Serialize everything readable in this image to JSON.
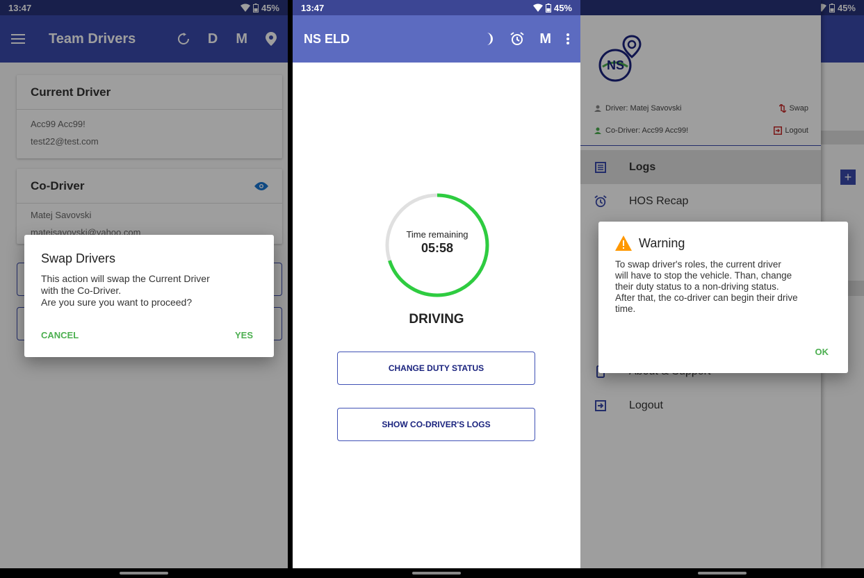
{
  "colors": {
    "primary": "#3949ab",
    "primary_dark": "#27327a",
    "accent_green": "#4caf50",
    "warning": "#ff9800",
    "ring_track": "#e0e0e0",
    "ring_fill": "#2ecc40"
  },
  "status_bar": {
    "time": "13:47",
    "battery": "45%"
  },
  "screen1": {
    "appbar": {
      "title": "Team Drivers",
      "actions": [
        "sync-icon",
        "D",
        "M",
        "location-icon"
      ]
    },
    "current_driver": {
      "heading": "Current Driver",
      "name": "Acc99 Acc99!",
      "email": "test22@test.com"
    },
    "co_driver": {
      "heading": "Co-Driver",
      "name": "Matej Savovski",
      "email": "matejsavovski@yahoo.com"
    },
    "dialog": {
      "title": "Swap Drivers",
      "message_line1": "This action will swap the Current Driver",
      "message_line2": "with the Co-Driver.",
      "message_line3": "Are you sure you want to proceed?",
      "cancel": "CANCEL",
      "confirm": "YES"
    }
  },
  "screen2": {
    "appbar": {
      "title": "NS ELD",
      "actions": [
        "moon-icon",
        "alarm-icon",
        "M",
        "more-icon"
      ]
    },
    "timer": {
      "label": "Time remaining",
      "value": "05:58",
      "progress_fraction": 0.7
    },
    "duty_status": "DRIVING",
    "buttons": {
      "change_duty": "CHANGE DUTY STATUS",
      "show_codriver_logs": "SHOW CO-DRIVER'S LOGS"
    }
  },
  "screen3": {
    "drawer": {
      "driver": "Driver: Matej Savovski",
      "co_driver": "Co-Driver: Acc99 Acc99!",
      "swap": "Swap",
      "logout_header": "Logout",
      "items": [
        {
          "label": "Logs",
          "icon": "list-icon",
          "active": true
        },
        {
          "label": "HOS Recap",
          "icon": "alarm-icon",
          "active": false
        },
        {
          "label": "About & Support",
          "icon": "phone-icon",
          "active": false
        },
        {
          "label": "Logout",
          "icon": "exit-icon",
          "active": false
        }
      ]
    },
    "dialog": {
      "title": "Warning",
      "line1": "To swap driver's roles, the current driver",
      "line2": "will have to stop the vehicle. Than, change",
      "line3": "their duty status to a non-driving status.",
      "line4": "After that, the co-driver can begin their drive",
      "line5": "time.",
      "ok": "OK"
    }
  }
}
